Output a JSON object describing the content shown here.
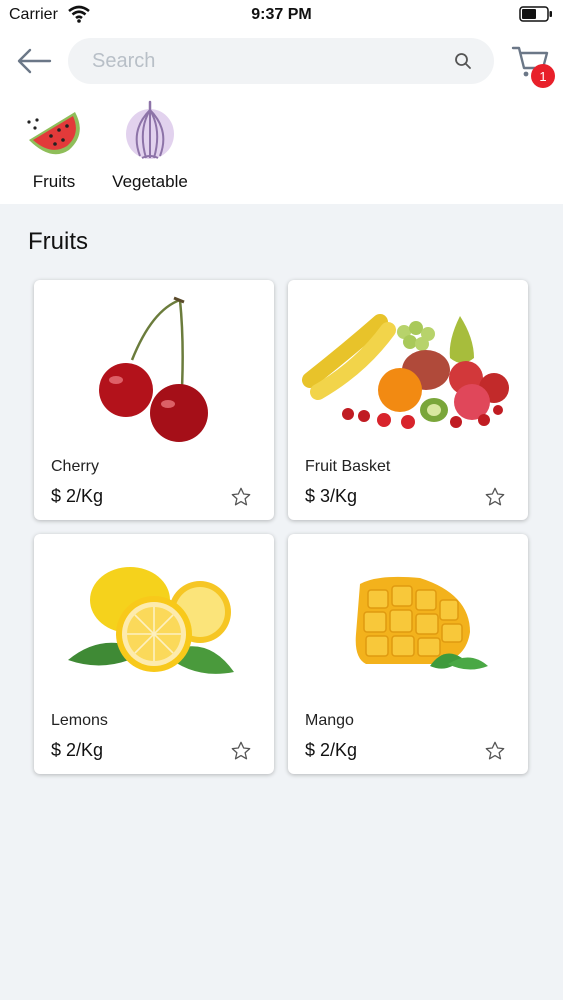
{
  "status_bar": {
    "carrier": "Carrier",
    "time": "9:37 PM"
  },
  "header": {
    "search_placeholder": "Search",
    "cart_count": "1"
  },
  "categories": [
    {
      "label": "Fruits",
      "icon": "watermelon-icon"
    },
    {
      "label": "Vegetable",
      "icon": "onion-icon"
    }
  ],
  "section": {
    "title": "Fruits"
  },
  "products": [
    {
      "name": "Cherry",
      "price": "$ 2/Kg",
      "image": "cherry-image"
    },
    {
      "name": "Fruit Basket",
      "price": "$ 3/Kg",
      "image": "fruit-basket-image"
    },
    {
      "name": "Lemons",
      "price": "$ 2/Kg",
      "image": "lemons-image"
    },
    {
      "name": "Mango",
      "price": "$ 2/Kg",
      "image": "mango-image"
    }
  ],
  "colors": {
    "badge": "#e8202a",
    "background": "#f0f3f6",
    "search_bg": "#f1f3f5"
  }
}
